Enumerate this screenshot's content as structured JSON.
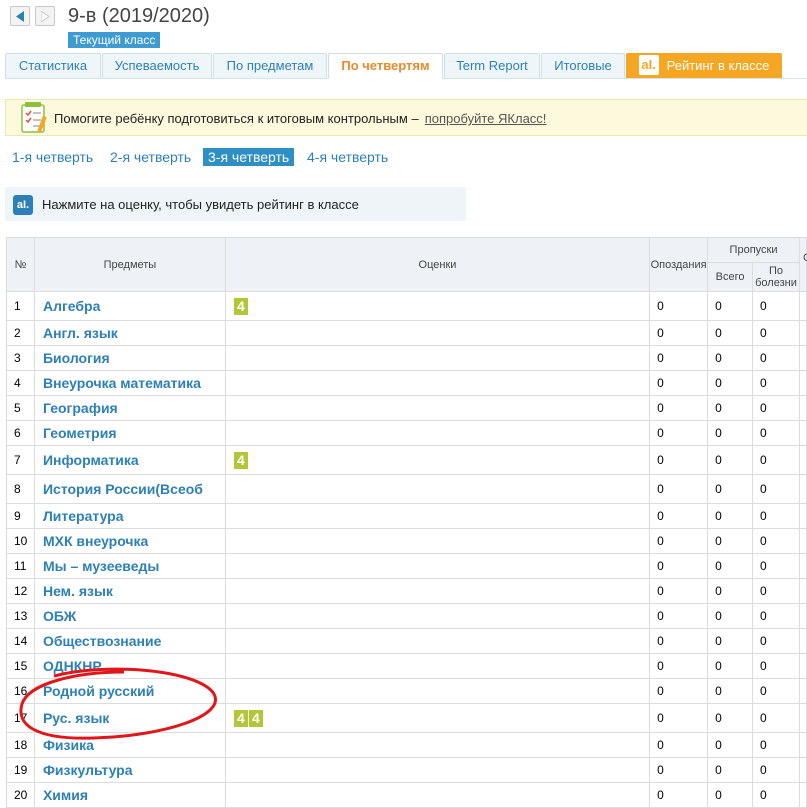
{
  "header": {
    "class_title": "9-в (2019/2020)",
    "current_class_badge": "Текущий класс"
  },
  "tabs": [
    {
      "label": "Статистика"
    },
    {
      "label": "Успеваемость"
    },
    {
      "label": "По предметам"
    },
    {
      "label": "По четвертям"
    },
    {
      "label": "Term Report"
    },
    {
      "label": "Итоговые"
    },
    {
      "label": "Рейтинг в классе"
    }
  ],
  "promo": {
    "text": "Помогите ребёнку подготовиться к итоговым контрольным –",
    "link": "попробуйте ЯКласс!"
  },
  "quarters": [
    "1-я четверть",
    "2-я четверть",
    "3-я четверть",
    "4-я четверть"
  ],
  "info": {
    "logo": "aI.",
    "text": "Нажмите на оценку, чтобы увидеть рейтинг в классе"
  },
  "table": {
    "headers": {
      "num": "№",
      "subjects": "Предметы",
      "marks": "Оценки",
      "lates": "Опоздания",
      "absences": "Пропуски",
      "total": "Всего",
      "sick": "По болезни",
      "cutoff": "С"
    },
    "rows": [
      {
        "num": "1",
        "subject": "Алгебра",
        "marks": [
          "4"
        ],
        "lates": "0",
        "total": "0",
        "sick": "0"
      },
      {
        "num": "2",
        "subject": "Англ. язык",
        "marks": [],
        "lates": "0",
        "total": "0",
        "sick": "0"
      },
      {
        "num": "3",
        "subject": "Биология",
        "marks": [],
        "lates": "0",
        "total": "0",
        "sick": "0"
      },
      {
        "num": "4",
        "subject": "Внеурочка математика",
        "marks": [],
        "lates": "0",
        "total": "0",
        "sick": "0"
      },
      {
        "num": "5",
        "subject": "География",
        "marks": [],
        "lates": "0",
        "total": "0",
        "sick": "0"
      },
      {
        "num": "6",
        "subject": "Геометрия",
        "marks": [],
        "lates": "0",
        "total": "0",
        "sick": "0"
      },
      {
        "num": "7",
        "subject": "Информатика",
        "marks": [
          "4"
        ],
        "lates": "0",
        "total": "0",
        "sick": "0"
      },
      {
        "num": "8",
        "subject": "История России(Всеоб",
        "marks": [],
        "lates": "0",
        "total": "0",
        "sick": "0"
      },
      {
        "num": "9",
        "subject": "Литература",
        "marks": [],
        "lates": "0",
        "total": "0",
        "sick": "0"
      },
      {
        "num": "10",
        "subject": "МХК внеурочка",
        "marks": [],
        "lates": "0",
        "total": "0",
        "sick": "0"
      },
      {
        "num": "11",
        "subject": "Мы – музееведы",
        "marks": [],
        "lates": "0",
        "total": "0",
        "sick": "0"
      },
      {
        "num": "12",
        "subject": "Нем. язык",
        "marks": [],
        "lates": "0",
        "total": "0",
        "sick": "0"
      },
      {
        "num": "13",
        "subject": "ОБЖ",
        "marks": [],
        "lates": "0",
        "total": "0",
        "sick": "0"
      },
      {
        "num": "14",
        "subject": "Обществознание",
        "marks": [],
        "lates": "0",
        "total": "0",
        "sick": "0"
      },
      {
        "num": "15",
        "subject": "ОДНКНР",
        "marks": [],
        "lates": "0",
        "total": "0",
        "sick": "0"
      },
      {
        "num": "16",
        "subject": "Родной русский",
        "marks": [],
        "lates": "0",
        "total": "0",
        "sick": "0"
      },
      {
        "num": "17",
        "subject": "Рус. язык",
        "marks": [
          "4",
          "4"
        ],
        "lates": "0",
        "total": "0",
        "sick": "0"
      },
      {
        "num": "18",
        "subject": "Физика",
        "marks": [],
        "lates": "0",
        "total": "0",
        "sick": "0"
      },
      {
        "num": "19",
        "subject": "Физкультура",
        "marks": [],
        "lates": "0",
        "total": "0",
        "sick": "0"
      },
      {
        "num": "20",
        "subject": "Химия",
        "marks": [],
        "lates": "0",
        "total": "0",
        "sick": "0"
      }
    ]
  },
  "colors": {
    "accent": "#2d80b7",
    "active_tab_text": "#e88a2d",
    "rating_tab": "#f5a623",
    "mark_bg": "#b2c638",
    "annotation": "#e0161b"
  }
}
